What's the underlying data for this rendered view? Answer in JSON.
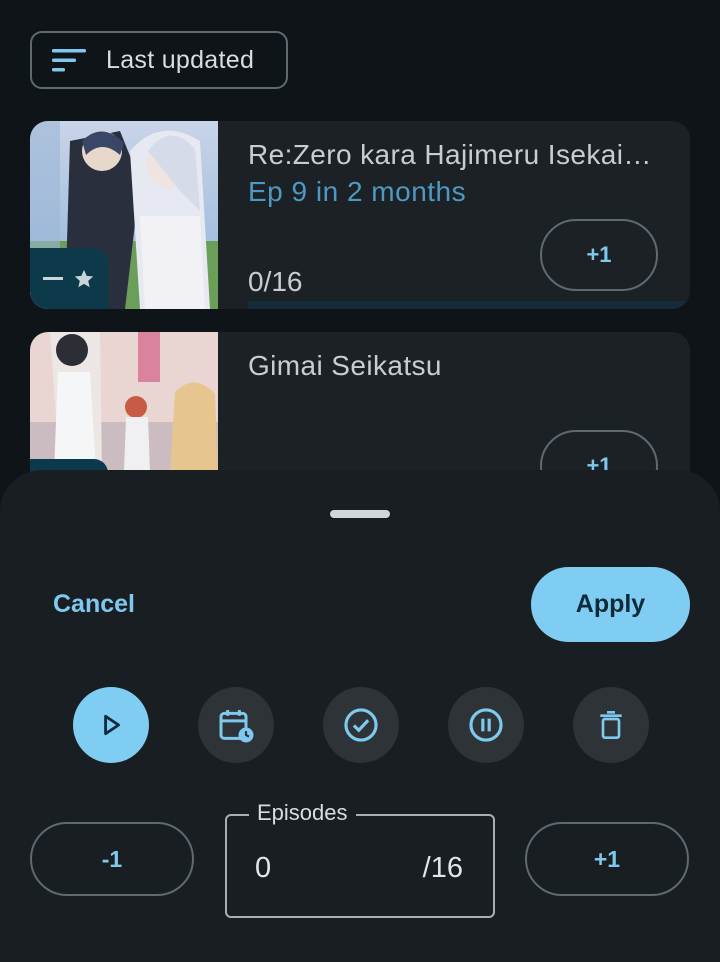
{
  "sort": {
    "icon": "sort-icon",
    "label": "Last updated"
  },
  "list": [
    {
      "title": "Re:Zero kara Hajimeru Isekai Seikatsu",
      "next_episode": "Ep 9 in 2 months",
      "progress": "0/16",
      "progress_fraction": 0,
      "increment_label": "+1",
      "badge_icons": [
        "minus-icon",
        "star-icon"
      ]
    },
    {
      "title": "Gimai Seikatsu",
      "next_episode": "",
      "progress": "",
      "increment_label": "+1"
    }
  ],
  "sheet": {
    "cancel_label": "Cancel",
    "apply_label": "Apply",
    "status_buttons": [
      {
        "icon": "play-icon",
        "selected": true
      },
      {
        "icon": "calendar-clock-icon",
        "selected": false
      },
      {
        "icon": "check-circle-icon",
        "selected": false
      },
      {
        "icon": "pause-circle-icon",
        "selected": false
      },
      {
        "icon": "trash-icon",
        "selected": false
      }
    ],
    "decrement_label": "-1",
    "increment_label": "+1",
    "episodes_label": "Episodes",
    "episodes_value": "0",
    "episodes_total": "/16"
  },
  "colors": {
    "accent": "#7fcdf3",
    "link": "#4d99c2",
    "background": "#0f1418",
    "sheet": "#191e22"
  }
}
